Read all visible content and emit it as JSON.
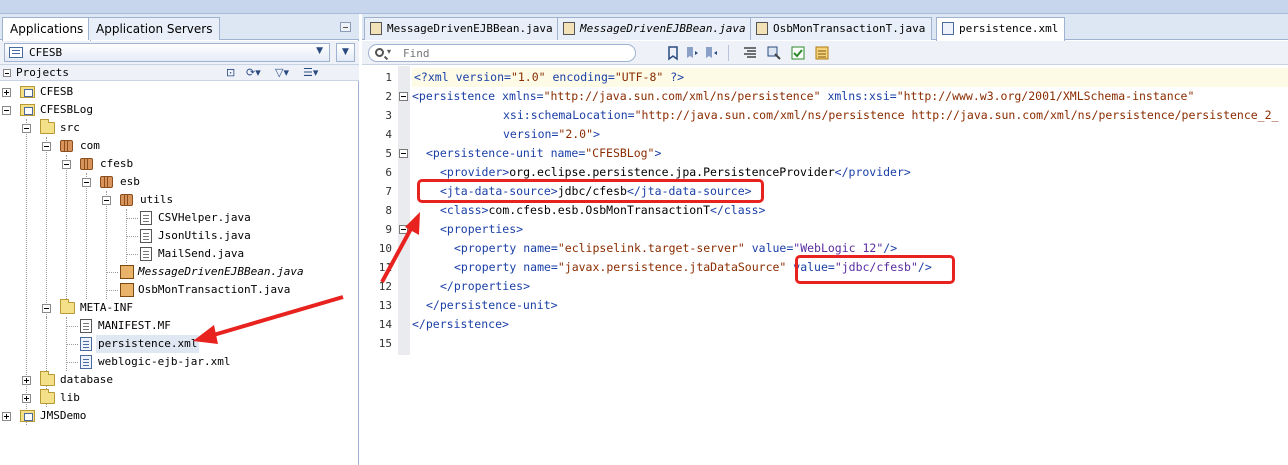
{
  "left_panel": {
    "tabs": [
      {
        "label": "Applications",
        "active": true
      },
      {
        "label": "Application Servers",
        "active": false
      }
    ],
    "application_selector": {
      "value": "CFESB"
    },
    "projects_label": "Projects",
    "tree": [
      {
        "label": "CFESB",
        "type": "project",
        "expanded": false
      },
      {
        "label": "CFESBLog",
        "type": "project",
        "expanded": true
      },
      {
        "label": "src",
        "type": "folder",
        "expanded": true
      },
      {
        "label": "com",
        "type": "package",
        "expanded": true
      },
      {
        "label": "cfesb",
        "type": "package",
        "expanded": true
      },
      {
        "label": "esb",
        "type": "package",
        "expanded": true
      },
      {
        "label": "utils",
        "type": "package",
        "expanded": true
      },
      {
        "label": "CSVHelper.java",
        "type": "java"
      },
      {
        "label": "JsonUtils.java",
        "type": "java"
      },
      {
        "label": "MailSend.java",
        "type": "java"
      },
      {
        "label": "MessageDrivenEJBBean.java",
        "type": "bean",
        "italic": true
      },
      {
        "label": "OsbMonTransactionT.java",
        "type": "bean"
      },
      {
        "label": "META-INF",
        "type": "folder",
        "expanded": true
      },
      {
        "label": "MANIFEST.MF",
        "type": "file"
      },
      {
        "label": "persistence.xml",
        "type": "xml",
        "selected": true
      },
      {
        "label": "weblogic-ejb-jar.xml",
        "type": "xml"
      },
      {
        "label": "database",
        "type": "folder",
        "expanded": false
      },
      {
        "label": "lib",
        "type": "folder",
        "expanded": false
      },
      {
        "label": "JMSDemo",
        "type": "project",
        "expanded": false
      }
    ]
  },
  "editor": {
    "tabs": [
      {
        "label": "MessageDrivenEJBBean.java",
        "italic": false,
        "active": false
      },
      {
        "label": "MessageDrivenEJBBean.java",
        "italic": true,
        "active": false
      },
      {
        "label": "OsbMonTransactionT.java",
        "italic": false,
        "active": false
      },
      {
        "label": "persistence.xml",
        "italic": false,
        "active": true
      }
    ],
    "find_placeholder": "Find",
    "line_numbers": [
      "1",
      "2",
      "3",
      "4",
      "5",
      "6",
      "7",
      "8",
      "9",
      "10",
      "11",
      "12",
      "13",
      "14",
      "15"
    ],
    "code": {
      "l1": {
        "t1": "<?",
        "t2": "xml",
        "a1": " version=",
        "v1": "\"1.0\"",
        "a2": " encoding=",
        "v2": "\"UTF-8\"",
        "t3": " ?>"
      },
      "l2": {
        "t1": "<persistence",
        "a1": " xmlns=",
        "v1": "\"http://java.sun.com/xml/ns/persistence\"",
        "a2": " xmlns:xsi=",
        "v2": "\"http://www.w3.org/2001/XMLSchema-instance\""
      },
      "l3": {
        "a1": "xsi:schemaLocation=",
        "v1": "\"http://java.sun.com/xml/ns/persistence http://java.sun.com/xml/ns/persistence/persistence_2_"
      },
      "l4": {
        "a1": "version=",
        "v1": "\"2.0\"",
        "t1": ">"
      },
      "l5": {
        "t1": "<persistence-unit",
        "a1": " name=",
        "v1": "\"CFESBLog\"",
        "t2": ">"
      },
      "l6": {
        "t1": "<provider>",
        "tx": "org.eclipse.persistence.jpa.PersistenceProvider",
        "t2": "</provider>"
      },
      "l7": {
        "t1": "<jta-data-source>",
        "tx": "jdbc/cfesb",
        "t2": "</jta-data-source>"
      },
      "l8": {
        "t1": "<class>",
        "tx": "com.cfesb.esb.OsbMonTransactionT",
        "t2": "</class>"
      },
      "l9": {
        "t1": "<properties>"
      },
      "l10": {
        "t1": "<property",
        "a1": " name=",
        "v1": "\"eclipselink.target-server\"",
        "a2": " value=",
        "v2": "\"WebLogic 12\"",
        "t2": "/>"
      },
      "l11": {
        "t1": "<property",
        "a1": " name=",
        "v1": "\"javax.persistence.jtaDataSource\"",
        "a2": " value=",
        "v2": "\"jdbc/cfesb\"",
        "t2": "/>"
      },
      "l12": {
        "t1": "</properties>"
      },
      "l13": {
        "t1": "</persistence-unit>"
      },
      "l14": {
        "t1": "</persistence>"
      }
    }
  },
  "colors": {
    "annotation_red": "#e8231f",
    "tag_blue": "#1a3fa6",
    "value_brown": "#8a2c00"
  }
}
